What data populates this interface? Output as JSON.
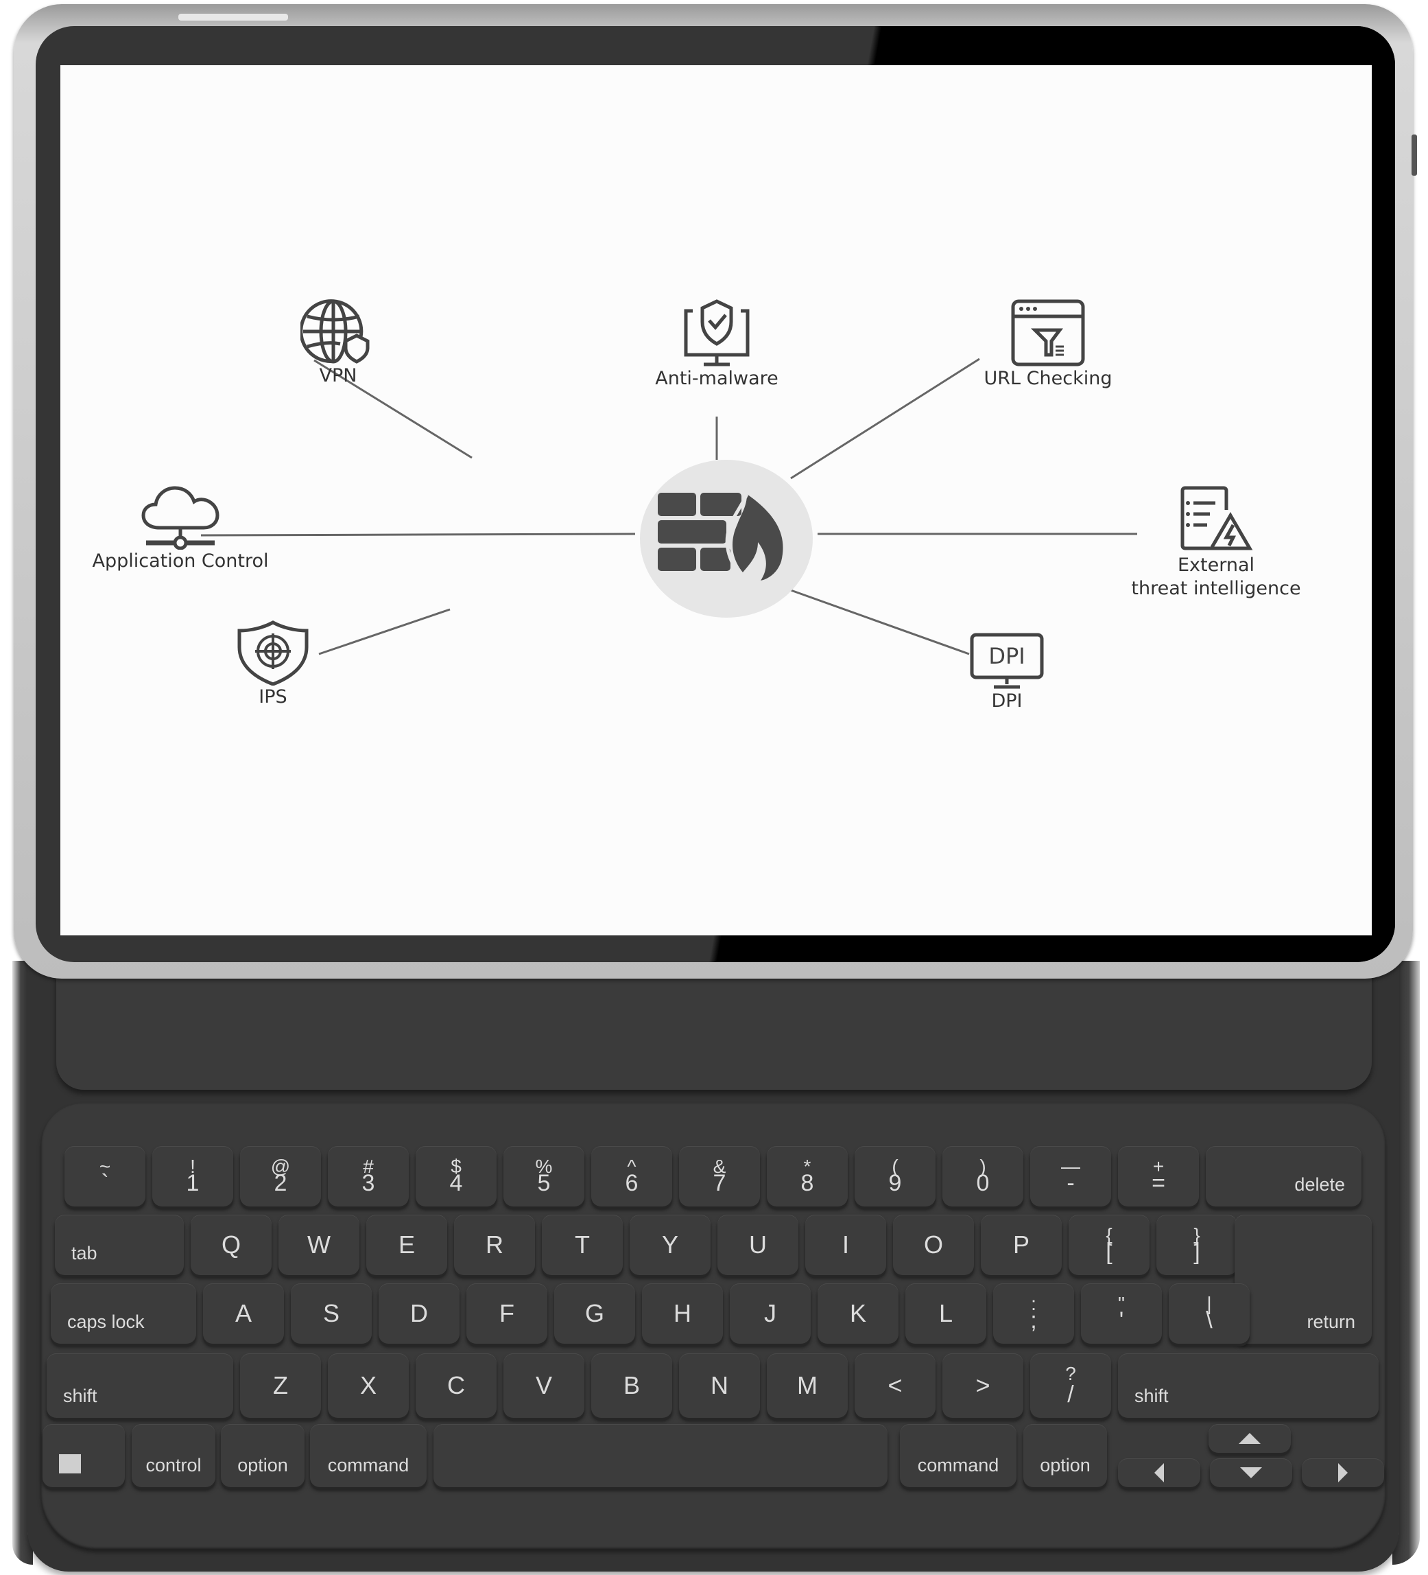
{
  "device": {
    "type": "tablet-with-keyboard-case"
  },
  "screen": {
    "diagram": {
      "center": {
        "name": "Firewall",
        "icon": "firewall-icon"
      },
      "nodes": [
        {
          "id": "vpn",
          "label": "VPN",
          "icon": "globe-shield-icon"
        },
        {
          "id": "anti-malware",
          "label": "Anti-malware",
          "icon": "monitor-shield-check-icon"
        },
        {
          "id": "url-checking",
          "label": "URL Checking",
          "icon": "browser-filter-icon"
        },
        {
          "id": "application-control",
          "label": "Application Control",
          "icon": "cloud-network-icon"
        },
        {
          "id": "external-threat-intelligence",
          "label_line1": "External",
          "label_line2": "threat intelligence",
          "icon": "document-warning-icon"
        },
        {
          "id": "ips",
          "label": "IPS",
          "icon": "shield-target-icon"
        },
        {
          "id": "dpi",
          "label": "DPI",
          "icon_text": "DPI",
          "icon": "monitor-dpi-icon"
        }
      ],
      "colors": {
        "icon": "#444444",
        "line": "#666666",
        "hub": "#e6e6e6",
        "text": "#333333"
      }
    }
  },
  "keyboard": {
    "row1": [
      {
        "top": "~",
        "bot": "`"
      },
      {
        "top": "!",
        "bot": "1"
      },
      {
        "top": "@",
        "bot": "2"
      },
      {
        "top": "#",
        "bot": "3"
      },
      {
        "top": "$",
        "bot": "4"
      },
      {
        "top": "%",
        "bot": "5"
      },
      {
        "top": "^",
        "bot": "6"
      },
      {
        "top": "&",
        "bot": "7"
      },
      {
        "top": "*",
        "bot": "8"
      },
      {
        "top": "(",
        "bot": "9"
      },
      {
        "top": ")",
        "bot": "0"
      },
      {
        "top": "—",
        "bot": "-"
      },
      {
        "top": "+",
        "bot": "="
      }
    ],
    "delete": "delete",
    "tab": "tab",
    "row2": [
      "Q",
      "W",
      "E",
      "R",
      "T",
      "Y",
      "U",
      "I",
      "O",
      "P"
    ],
    "row2_symbols": [
      {
        "top": "{",
        "bot": "["
      },
      {
        "top": "}",
        "bot": "]"
      }
    ],
    "caps_lock": "caps lock",
    "row3": [
      "A",
      "S",
      "D",
      "F",
      "G",
      "H",
      "J",
      "K",
      "L"
    ],
    "row3_symbols": [
      {
        "top": ":",
        "bot": ";"
      },
      {
        "top": "\"",
        "bot": "'"
      },
      {
        "top": "|",
        "bot": "\\"
      }
    ],
    "return": "return",
    "shift_left": "shift",
    "row4": [
      "Z",
      "X",
      "C",
      "V",
      "B",
      "N",
      "M",
      "<",
      ">"
    ],
    "row4_symbol": {
      "top": "?",
      "bot": "/"
    },
    "shift_right": "shift",
    "control": "control",
    "option_left": "option",
    "command_left": "command",
    "command_right": "command",
    "option_right": "option",
    "colors": {
      "key": "#3c3c3c",
      "legend": "#dcdcdc",
      "case": "#333333"
    }
  }
}
